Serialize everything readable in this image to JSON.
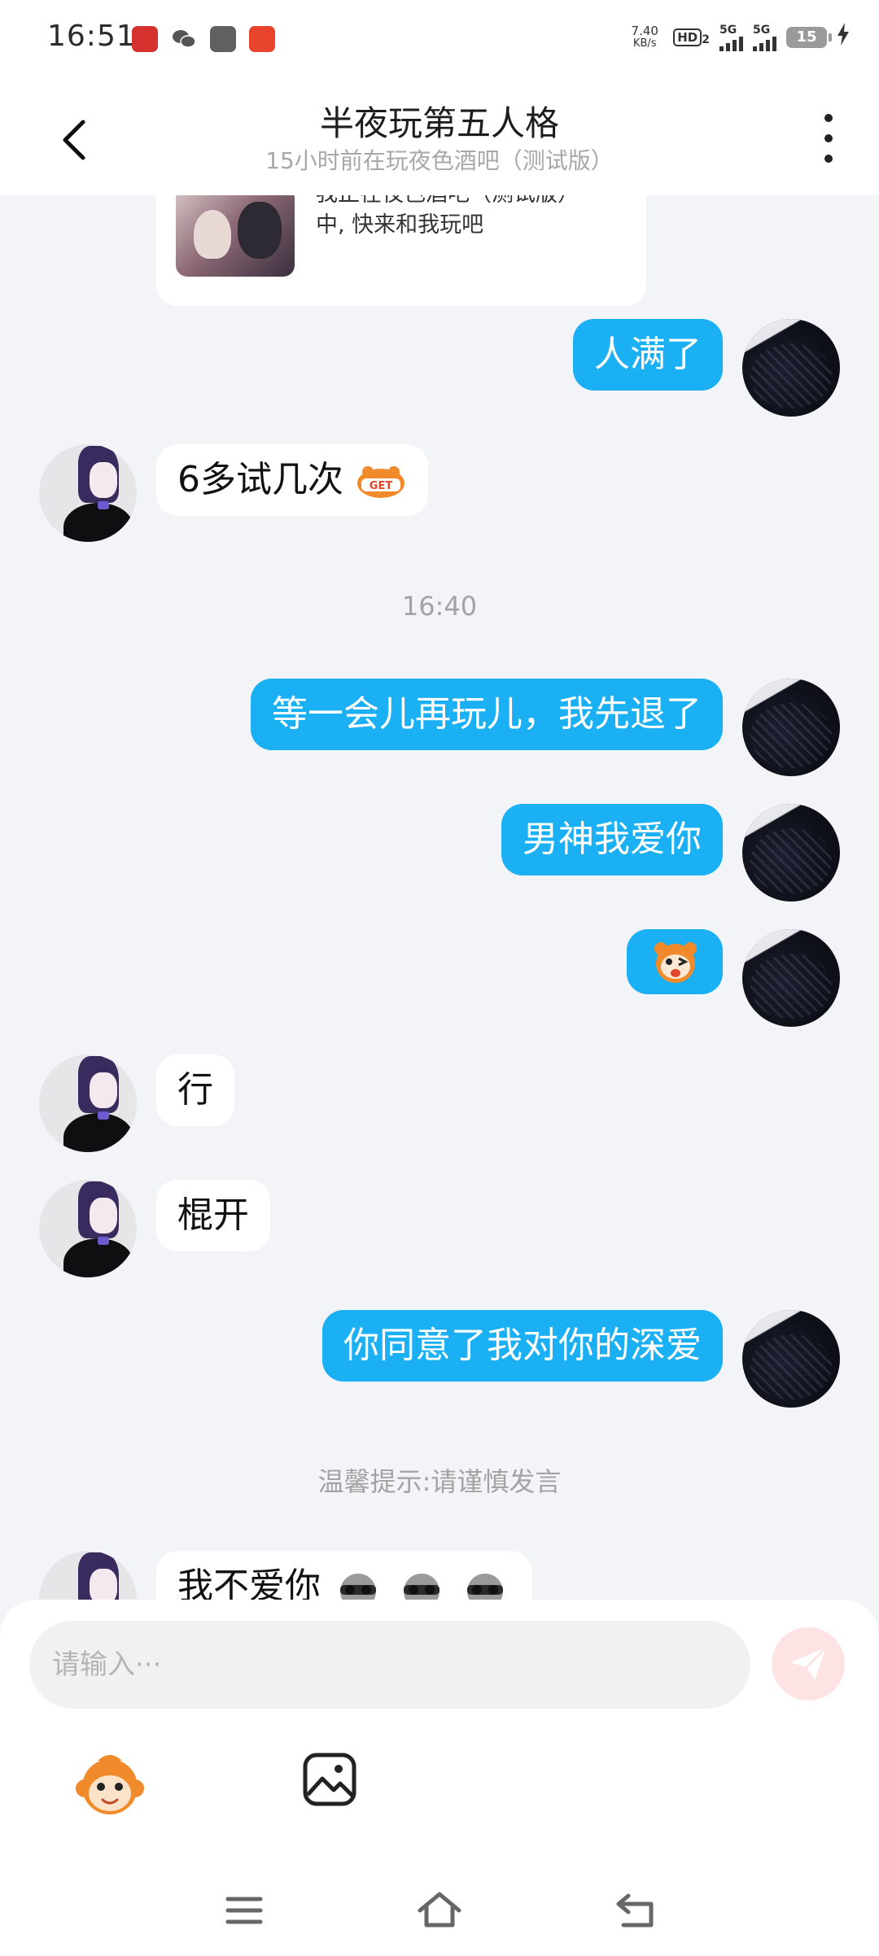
{
  "status": {
    "time": "16:51",
    "net_speed_value": "7.40",
    "net_speed_unit": "KB/s",
    "hd": "HD",
    "hd_sub": "2",
    "sim1": "5G",
    "sim2": "5G",
    "battery": "15",
    "apps": [
      "news-app-icon",
      "wechat-icon",
      "gray-app-icon",
      "taobao-icon"
    ]
  },
  "header": {
    "title": "半夜玩第五人格",
    "subtitle": "15小时前在玩夜色酒吧（测试版）"
  },
  "share_card": {
    "line1": "我正在夜色酒吧（测试版）",
    "line2": "中, 快来和我玩吧"
  },
  "messages": [
    {
      "side": "mine",
      "text": "人满了"
    },
    {
      "side": "peer",
      "text": "6多试几次",
      "emoji": "get-emoji"
    },
    {
      "type": "time",
      "text": "16:40"
    },
    {
      "side": "mine",
      "text": "等一会儿再玩儿，我先退了"
    },
    {
      "side": "mine",
      "text": "男神我爱你"
    },
    {
      "side": "mine",
      "emoji": "wink-tongue-emoji"
    },
    {
      "side": "peer",
      "text": "行"
    },
    {
      "side": "peer",
      "text": "棍开"
    },
    {
      "side": "mine",
      "text": "你同意了我对你的深爱"
    },
    {
      "type": "tip",
      "text": "温馨提示:请谨慎发言"
    },
    {
      "side": "peer",
      "text": "我不爱你",
      "emoji": "sunglasses-emoji x3"
    }
  ],
  "composer": {
    "placeholder": "请输入···"
  },
  "colors": {
    "my_bubble": "#1ab0f3",
    "peer_bubble": "#ffffff",
    "background": "#f2f4f7",
    "send_button": "#fde3e3"
  }
}
